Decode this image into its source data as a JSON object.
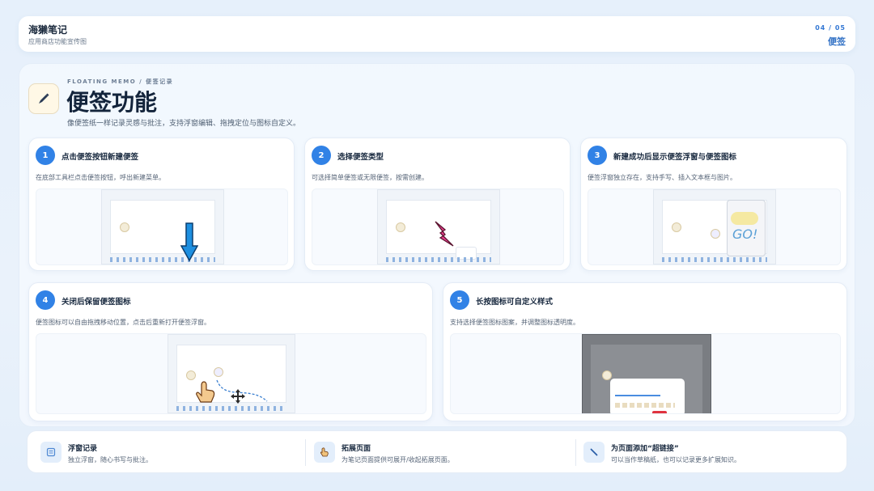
{
  "header": {
    "app_title": "海獭笔记",
    "app_subtitle": "应用商店功能宣传图",
    "page_no": "04 / 05",
    "page_name": "便签"
  },
  "hero": {
    "eyebrow": "FLOATING MEMO / 便签记录",
    "title": "便签功能",
    "desc": "像便签纸一样记录灵感与批注，支持浮窗编辑、拖拽定位与图标自定义。",
    "icon": "pen-icon"
  },
  "steps": [
    {
      "num": "1",
      "title": "点击便签按钮新建便签",
      "desc": "在底部工具栏点击便签按钮，呼出新建菜单。"
    },
    {
      "num": "2",
      "title": "选择便签类型",
      "desc": "可选择简单便签或无限便签，按需创建。"
    },
    {
      "num": "3",
      "title": "新建成功后显示便签浮窗与便签图标",
      "desc": "便签浮窗独立存在，支持手写、插入文本框与图片。"
    },
    {
      "num": "4",
      "title": "关闭后保留便签图标",
      "desc": "便签图标可以自由拖拽移动位置，点击后重新打开便签浮窗。"
    },
    {
      "num": "5",
      "title": "长按图标可自定义样式",
      "desc": "支持选择便签图标图案，并调整图标透明度。"
    }
  ],
  "mock": {
    "memo_text": "GO!"
  },
  "features": [
    {
      "title": "浮窗记录",
      "desc": "独立浮窗，随心书写与批注。",
      "icon": "note-icon"
    },
    {
      "title": "拓展页面",
      "desc": "为笔记页面提供可展开/收起拓展页面。",
      "icon": "hand-icon"
    },
    {
      "title": "为页面添加“超链接”",
      "desc": "可以当作草稿纸，也可以记录更多扩展知识。",
      "icon": "link-icon"
    }
  ],
  "colors": {
    "accent": "#3182e6",
    "arrow": "#1d8fe0",
    "lightning": "#e83e8c"
  }
}
